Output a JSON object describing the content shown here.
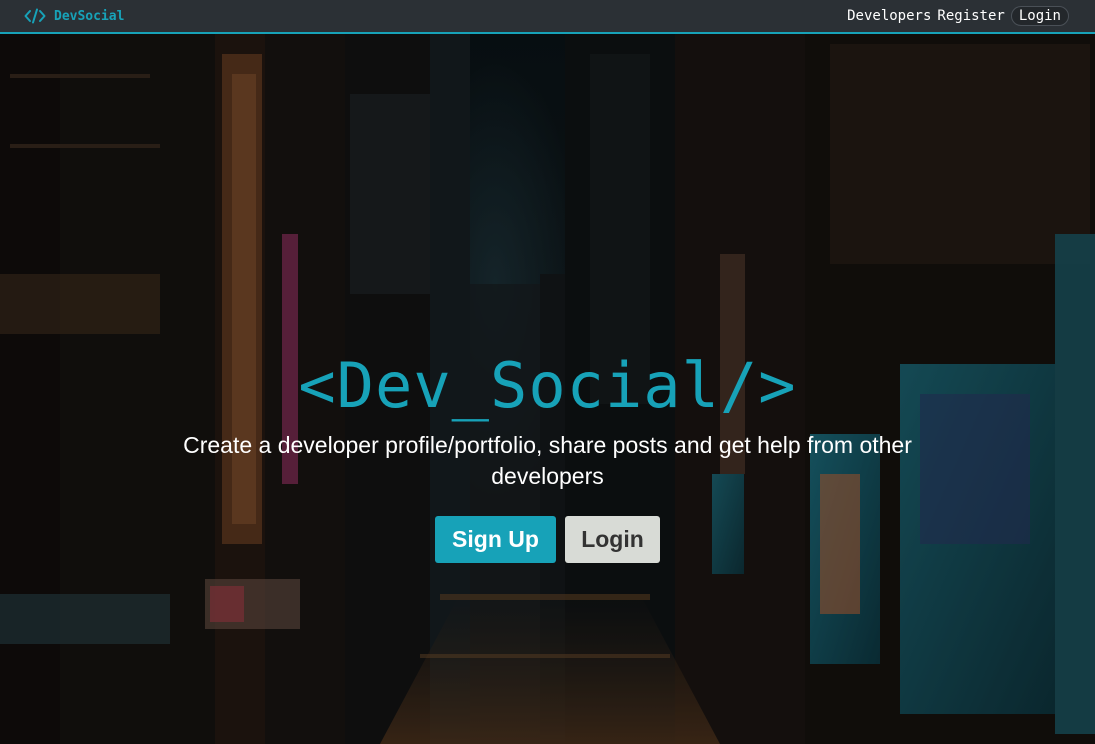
{
  "navbar": {
    "brand": "DevSocial",
    "links": [
      "Developers",
      "Register",
      "Login"
    ]
  },
  "hero": {
    "title": "<Dev_Social/>",
    "subtitle": "Create a developer profile/portfolio, share posts and get help from other developers",
    "signup_label": "Sign Up",
    "login_label": "Login"
  },
  "colors": {
    "accent": "#17a2b8",
    "navbar_bg": "#2b3035",
    "light_button": "#d8dbd6"
  },
  "icons": {
    "brand": "code-icon"
  }
}
